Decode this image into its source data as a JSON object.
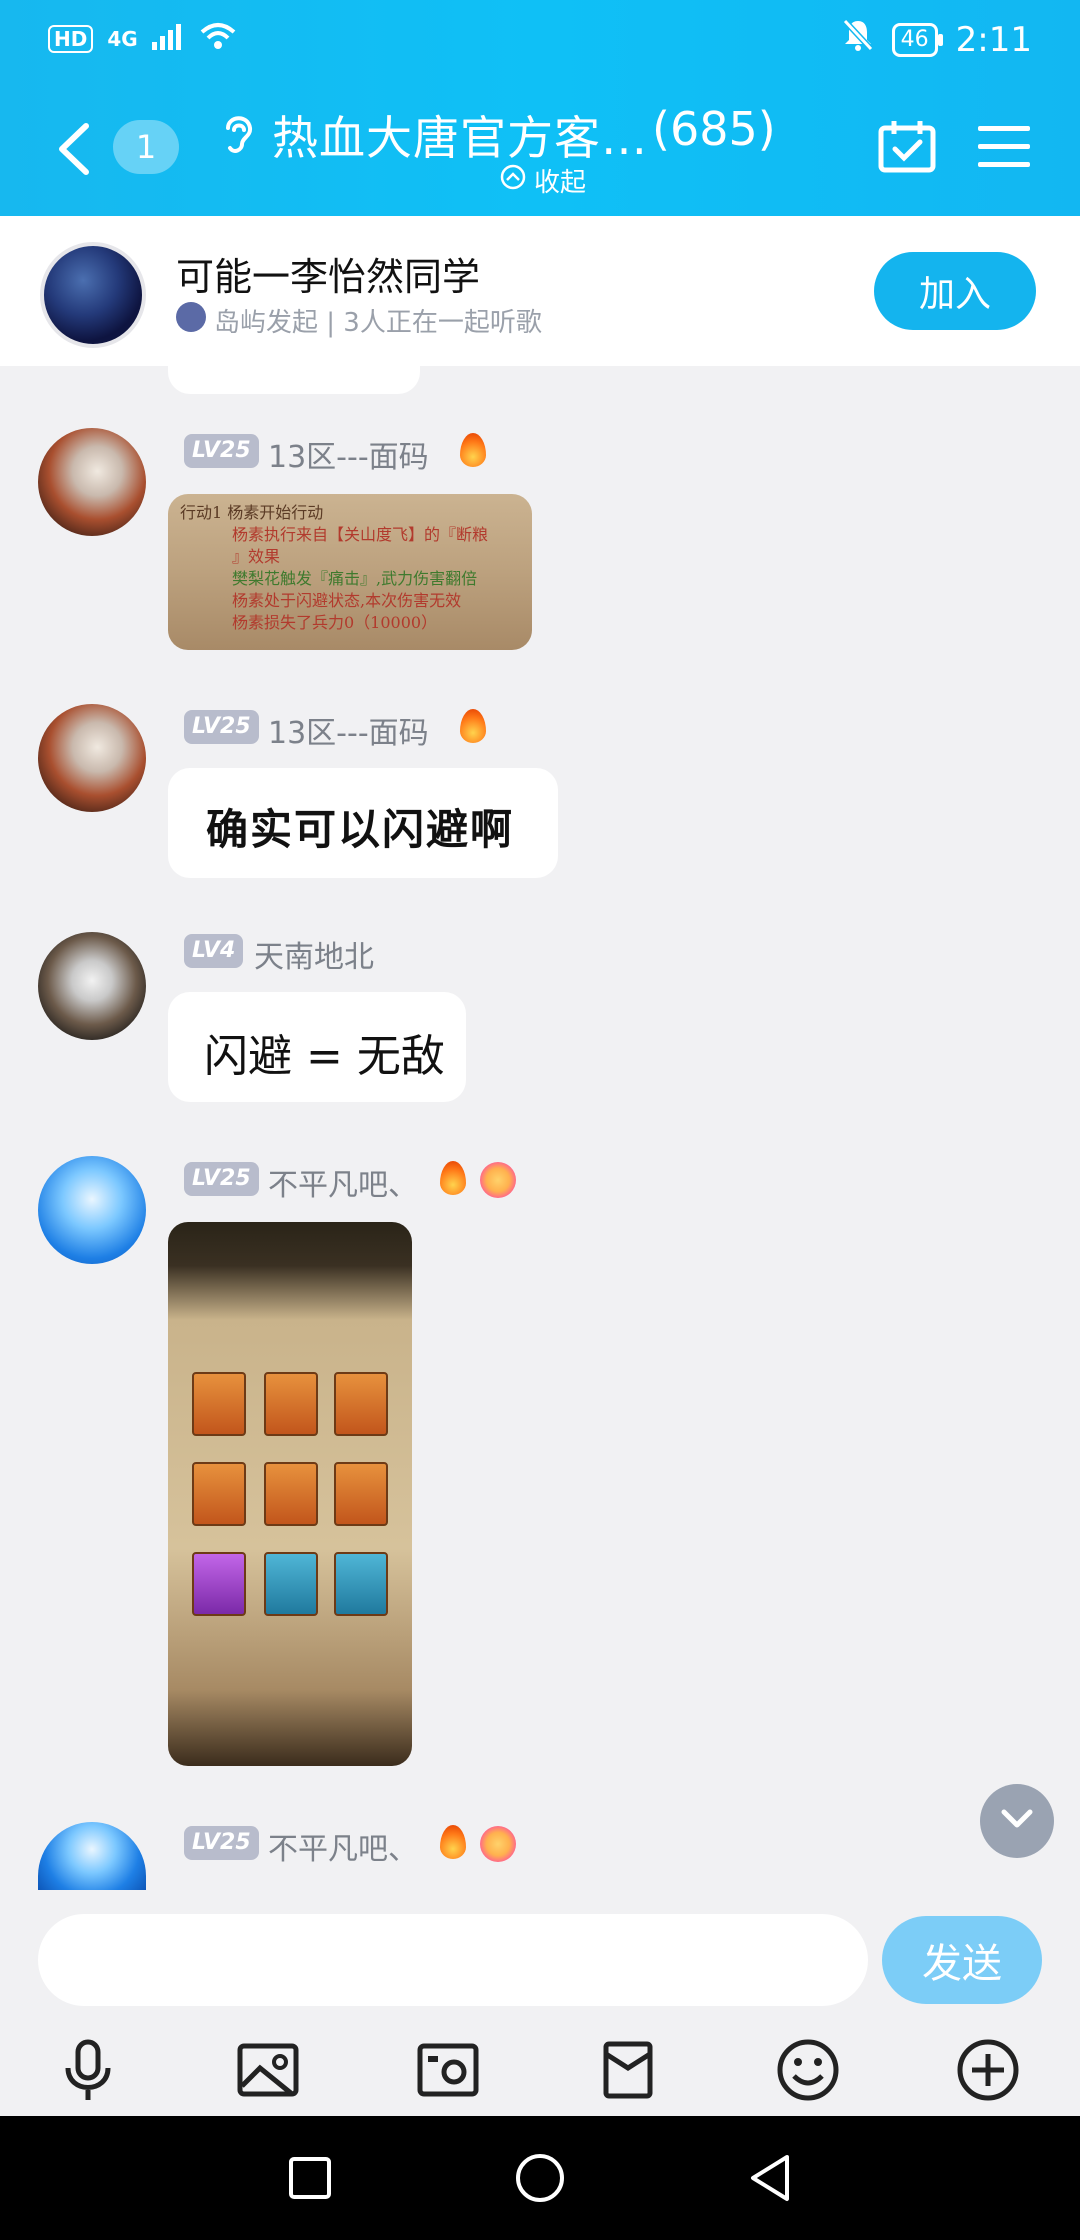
{
  "status_bar": {
    "hd": "HD",
    "network": "4G",
    "battery": "46",
    "time": "2:11"
  },
  "header": {
    "unread_count": "1",
    "title": "热血大唐官方客…",
    "member_count": "(685)",
    "collapse_label": "收起"
  },
  "listen_card": {
    "title": "可能一李怡然同学",
    "subtitle": "岛屿发起 | 3人正在一起听歌",
    "join_label": "加入"
  },
  "messages": [
    {
      "level": "LV25",
      "nickname": "13区---面码",
      "type": "image",
      "image_lines": [
        "行动1   杨素开始行动",
        "杨素执行来自【关山度飞】的『断粮",
        "』效果",
        "樊梨花触发『痛击』,武力伤害翻倍",
        "杨素处于闪避状态,本次伤害无效",
        "杨素损失了兵力0（10000）"
      ]
    },
    {
      "level": "LV25",
      "nickname": "13区---面码",
      "type": "text",
      "text": "确实可以闪避啊"
    },
    {
      "level": "LV4",
      "nickname": "天南地北",
      "type": "text",
      "text": "闪避 = 无敌"
    },
    {
      "level": "LV25",
      "nickname": "不平凡吧、",
      "type": "image",
      "image_caption": "game-formation-screenshot"
    },
    {
      "level": "LV25",
      "nickname": "不平凡吧、",
      "type": "text",
      "text": ""
    }
  ],
  "input": {
    "placeholder": "",
    "send_label": "发送"
  },
  "toolbar_icons": [
    "microphone-icon",
    "image-icon",
    "camera-icon",
    "red-packet-icon",
    "emoji-icon",
    "plus-icon"
  ],
  "nav_icons": [
    "recent-apps-icon",
    "home-icon",
    "back-icon"
  ]
}
